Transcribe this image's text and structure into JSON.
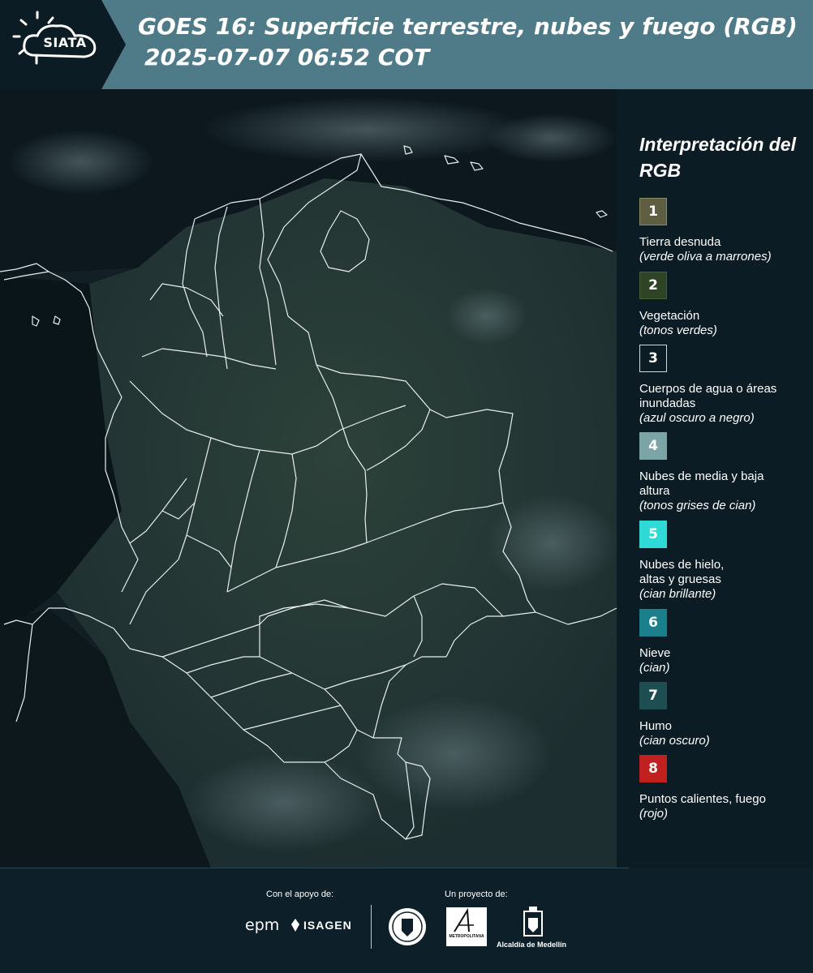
{
  "header": {
    "logo_text": "SIATA",
    "title_line1": "GOES 16: Superficie terrestre, nubes y fuego (RGB)",
    "title_line2": "2025-07-07 06:52 COT"
  },
  "legend": {
    "title": "Interpretación del RGB",
    "items": [
      {
        "number": "1",
        "label": "Tierra desnuda",
        "note": "(verde oliva a marrones)",
        "color": "#5f5e42"
      },
      {
        "number": "2",
        "label": "Vegetación",
        "note": "(tonos verdes)",
        "color": "#2f4425"
      },
      {
        "number": "3",
        "label": "Cuerpos de agua o áreas inundadas",
        "note": "(azul oscuro a negro)",
        "color": "#0b1c25"
      },
      {
        "number": "4",
        "label": "Nubes de media y baja altura",
        "note": "(tonos grises de cian)",
        "color": "#7aa4a6"
      },
      {
        "number": "5",
        "label": "Nubes de hielo, altas y gruesas",
        "note": "(cian brillante)",
        "color": "#2fd9d6"
      },
      {
        "number": "6",
        "label": "Nieve",
        "note": "(cian)",
        "color": "#1b7f8c"
      },
      {
        "number": "7",
        "label": "Humo",
        "note": "(cian oscuro)",
        "color": "#1c4e52"
      },
      {
        "number": "8",
        "label": "Puntos calientes, fuego",
        "note": "(rojo)",
        "color": "#c0201f"
      }
    ]
  },
  "footer": {
    "support_label": "Con el apoyo de:",
    "project_label": "Un proyecto de:",
    "sponsor_1": "epm",
    "sponsor_2": "ISAGEN",
    "partner_area": "METROPOLITANA",
    "partner_alcaldia": "Alcaldía de Medellín"
  },
  "icons": [
    "sun-icon",
    "cloud-icon",
    "seal-icon",
    "coat-of-arms-icon"
  ]
}
